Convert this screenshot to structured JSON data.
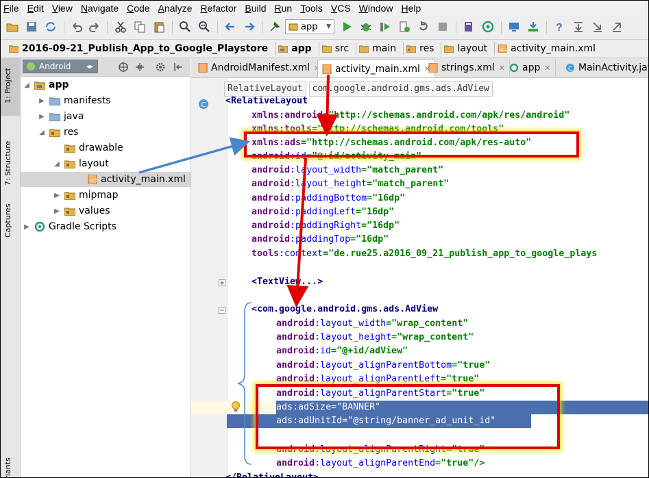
{
  "menu": [
    "File",
    "Edit",
    "View",
    "Navigate",
    "Code",
    "Analyze",
    "Refactor",
    "Build",
    "Run",
    "Tools",
    "VCS",
    "Window",
    "Help"
  ],
  "toolbar": {
    "run_config": "app"
  },
  "breadcrumb": [
    "2016-09-21_Publish_App_to_Google_Playstore",
    "app",
    "src",
    "main",
    "res",
    "layout",
    "activity_main.xml"
  ],
  "side_tabs": [
    "1: Project",
    "7: Structure",
    "Captures",
    "Variants"
  ],
  "project": {
    "view_mode": "Android",
    "tree": [
      {
        "label": "app",
        "bold": true
      },
      {
        "label": "manifests"
      },
      {
        "label": "java"
      },
      {
        "label": "res"
      },
      {
        "label": "drawable"
      },
      {
        "label": "layout"
      },
      {
        "label": "activity_main.xml"
      },
      {
        "label": "mipmap"
      },
      {
        "label": "values"
      },
      {
        "label": "Gradle Scripts"
      }
    ]
  },
  "editor_tabs": [
    "AndroidManifest.xml",
    "activity_main.xml",
    "strings.xml",
    "app",
    "MainActivity.java"
  ],
  "editor_breadcrumb": [
    "RelativeLayout",
    "com.google.android.gms.ads.AdView"
  ],
  "code": {
    "l0": "<RelativeLayout",
    "l1_ns": "xmlns:android",
    "l1_val": "=\"http://schemas.android.com/apk/res/android\"",
    "l2_ns": "xmlns:tools",
    "l2_val": "=\"http://schemas.android.com/tools\"",
    "l3_ns": "xmlns:ads",
    "l3_val": "=\"http://schemas.android.com/apk/res-auto\"",
    "l4_ns": "android",
    "l4_attr": ":id",
    "l4_val": "=\"@+id/activity_main\"",
    "l5_ns": "android",
    "l5_attr": ":layout_width",
    "l5_val": "=\"match_parent\"",
    "l6_ns": "android",
    "l6_attr": ":layout_height",
    "l6_val": "=\"match_parent\"",
    "l7_ns": "android",
    "l7_attr": ":paddingBottom",
    "l7_val": "=\"16dp\"",
    "l8_ns": "android",
    "l8_attr": ":paddingLeft",
    "l8_val": "=\"16dp\"",
    "l9_ns": "android",
    "l9_attr": ":paddingRight",
    "l9_val": "=\"16dp\"",
    "l10_ns": "android",
    "l10_attr": ":paddingTop",
    "l10_val": "=\"16dp\"",
    "l11_ns": "tools",
    "l11_attr": ":context",
    "l11_val": "=\"de.rue25.a2016_09_21_publish_app_to_google_plays",
    "l12": "<TextView...>",
    "l13": "<com.google.android.gms.ads.AdView",
    "l14_ns": "android",
    "l14_attr": ":layout_width",
    "l14_val": "=\"wrap_content\"",
    "l15_ns": "android",
    "l15_attr": ":layout_height",
    "l15_val": "=\"wrap_content\"",
    "l16_ns": "android",
    "l16_attr": ":id",
    "l16_val": "=\"@+id/adView\"",
    "l17_ns": "android",
    "l17_attr": ":layout_alignParentBottom",
    "l17_val": "=\"true\"",
    "l18_ns": "android",
    "l18_attr": ":layout_alignParentLeft",
    "l18_val": "=\"true\"",
    "l19_ns": "android",
    "l19_attr": ":layout_alignParentStart",
    "l19_val": "=\"true\"",
    "l20_ns": "ads",
    "l20_attr": ":adSize",
    "l20_val": "=\"BANNER\"",
    "l21_ns": "ads",
    "l21_attr": ":adUnitId",
    "l21_val": "=\"@string/banner_ad_unit_id\"",
    "l22_ns": "android",
    "l22_attr": ":layout_alignParentRight",
    "l22_val": "=\"true\"",
    "l23_ns": "android",
    "l23_attr": ":layout_alignParentEnd",
    "l23_val": "=\"true\"/>",
    "l24": "</RelativeLayout>"
  },
  "colors": {
    "annotation_red": "#e00000",
    "annotation_blue": "#4a86c8",
    "selection": "#4b6eaf"
  }
}
